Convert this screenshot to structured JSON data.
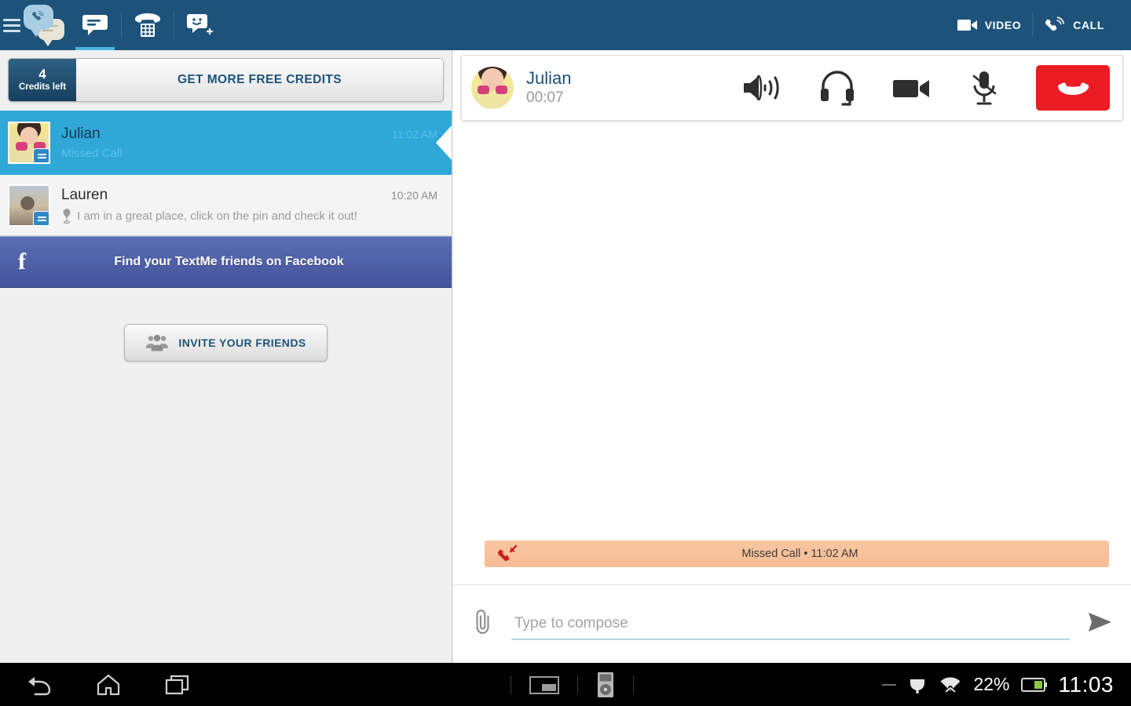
{
  "topbar": {
    "menu_icon": "hamburger-icon",
    "logo_icon": "textme-logo-icon",
    "tabs": [
      {
        "name": "messages",
        "icon": "chat-bubble-icon",
        "active": true
      },
      {
        "name": "dialer",
        "icon": "phone-keypad-icon",
        "active": false
      },
      {
        "name": "add-contact",
        "icon": "smiley-bubble-plus-icon",
        "active": false
      }
    ],
    "video_label": "VIDEO",
    "video_icon": "video-camera-icon",
    "call_label": "CALL",
    "call_icon": "phone-call-icon",
    "bg_color": "#1d537a",
    "active_indicator_color": "#49b7e0"
  },
  "left_panel": {
    "credits": {
      "count": "4",
      "count_label": "Credits left",
      "cta_label": "GET MORE FREE CREDITS"
    },
    "conversations": [
      {
        "name": "Julian",
        "time": "11:02 AM",
        "preview": "Missed Call",
        "selected": true,
        "avatar": "julian-avatar",
        "badge_icon": "chat-bubble-badge-icon",
        "has_pin": false
      },
      {
        "name": "Lauren",
        "time": "10:20 AM",
        "preview": "I am in a great place, click on the pin and check it out!",
        "selected": false,
        "avatar": "lauren-avatar",
        "badge_icon": "chat-bubble-badge-icon",
        "has_pin": true
      }
    ],
    "facebook_bar": {
      "icon": "facebook-f-icon",
      "label": "Find your TextMe friends on Facebook",
      "color": "#4a59a3"
    },
    "invite": {
      "label": "INVITE YOUR FRIENDS",
      "icon": "group-people-icon"
    },
    "selected_color": "#2fa8d8"
  },
  "call_panel": {
    "contact_name": "Julian",
    "duration": "00:07",
    "avatar": "julian-avatar",
    "controls": [
      {
        "name": "speaker",
        "icon": "speaker-on-icon"
      },
      {
        "name": "headset",
        "icon": "headset-icon"
      },
      {
        "name": "video",
        "icon": "video-camera-icon"
      },
      {
        "name": "mute",
        "icon": "microphone-muted-icon"
      }
    ],
    "hangup": {
      "label": "",
      "icon": "hang-up-phone-icon",
      "color": "#ec1c24"
    }
  },
  "thread": {
    "missed_call": {
      "icon": "missed-call-arrow-icon",
      "text": "Missed Call • 11:02 AM",
      "color": "#f6bd95"
    }
  },
  "compose": {
    "attach_icon": "paperclip-icon",
    "placeholder": "Type to compose",
    "value": "",
    "send_icon": "send-arrow-icon"
  },
  "system_bar": {
    "back_icon": "back-arrow-icon",
    "home_icon": "home-icon",
    "recents_icon": "recent-apps-icon",
    "keyboard_icon": "keyboard-icon",
    "media_icon": "media-device-icon",
    "dash_icon": "no-signal-icon",
    "usb_icon": "usb-icon",
    "wifi_icon": "wifi-icon",
    "battery_percent": "22%",
    "battery_icon": "battery-icon",
    "clock": "11:03"
  }
}
